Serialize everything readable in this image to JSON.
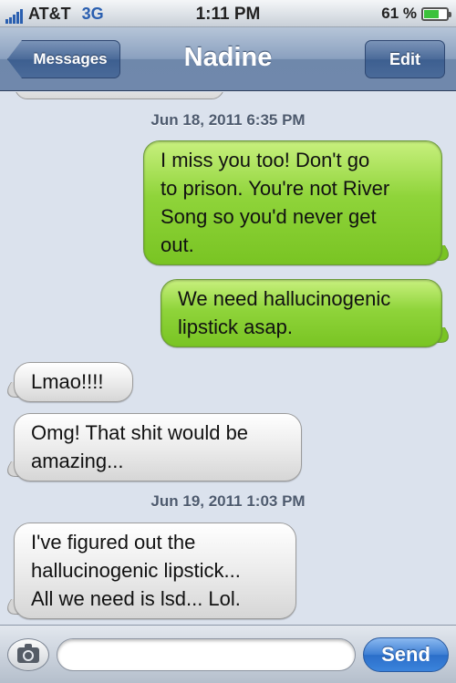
{
  "status_bar": {
    "carrier": "AT&T",
    "network": "3G",
    "time": "1:11 PM",
    "battery_text": "61 %",
    "battery_level": 0.61,
    "signal_bars": 5
  },
  "nav": {
    "back_label": "Messages",
    "title": "Nadine",
    "edit_label": "Edit"
  },
  "conversation": {
    "timestamps": [
      "Jun 18, 2011 6:35 PM",
      "Jun 19, 2011 1:03 PM"
    ],
    "messages": [
      {
        "direction": "sent",
        "lines": [
          "I miss you too! Don't go",
          "to prison. You're not River",
          "Song so you'd never get",
          "out."
        ]
      },
      {
        "direction": "sent",
        "lines": [
          "We need hallucinogenic",
          "lipstick asap."
        ]
      },
      {
        "direction": "received",
        "lines": [
          "Lmao!!!!"
        ]
      },
      {
        "direction": "received",
        "lines": [
          "Omg! That shit would be",
          "amazing..."
        ]
      },
      {
        "direction": "received",
        "lines": [
          "I've figured out the",
          "hallucinogenic lipstick...",
          "All we need is lsd... Lol."
        ]
      }
    ]
  },
  "composer": {
    "input_value": "",
    "send_label": "Send",
    "camera_icon": "camera-icon"
  },
  "colors": {
    "sent_bubble": "#8fd43a",
    "received_bubble": "#ececec",
    "nav_bar": "#7088ac",
    "send_button": "#3e7fd4"
  }
}
